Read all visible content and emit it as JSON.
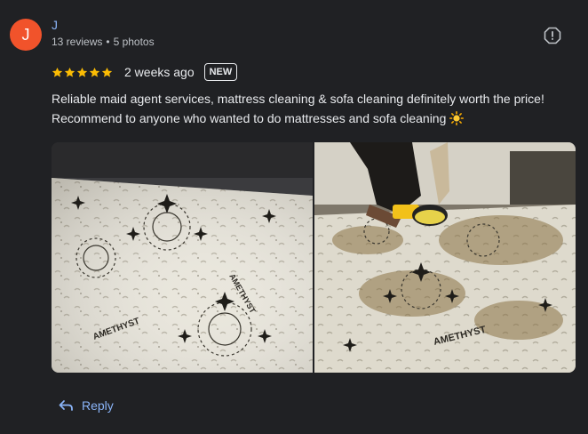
{
  "author": {
    "initial": "J",
    "name": "J",
    "reviews": "13 reviews",
    "separator": "•",
    "photos": "5 photos",
    "avatar_color": "#f1532b"
  },
  "rating": {
    "stars": 5,
    "star_color": "#fbbc04",
    "time_ago": "2 weeks ago",
    "badge": "NEW"
  },
  "review": {
    "line1": "Reliable maid agent services, mattress cleaning & sofa cleaning definitely worth the price!",
    "line2": "Recommend to anyone who wanted to do mattresses and sofa cleaning",
    "emoji_icon": "sun-icon"
  },
  "photos": [
    {
      "name": "clean-mattress-photo",
      "brand_text": "AMETHYST"
    },
    {
      "name": "stained-mattress-cleaning-photo",
      "brand_text": "AMETHYST"
    }
  ],
  "actions": {
    "reply_label": "Reply",
    "report_icon": "report-icon"
  },
  "colors": {
    "background": "#202124",
    "link": "#8ab4f8",
    "text": "#e8eaed"
  }
}
